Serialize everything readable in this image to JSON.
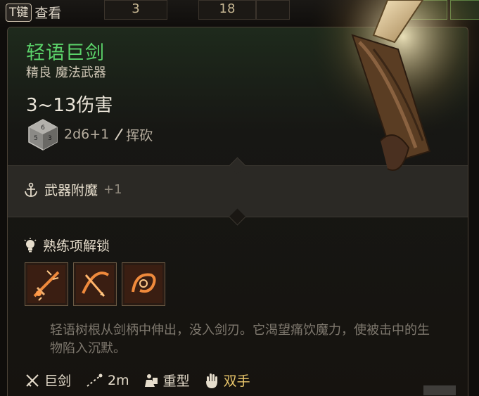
{
  "topbar": {
    "key_label": "T键",
    "view_label": "查看",
    "slot_value_1": "3",
    "slot_value_2": "18"
  },
  "item": {
    "name": "轻语巨剑",
    "rarity_type": "精良 魔法武器",
    "damage": "3~13伤害",
    "dice": "2d6+1",
    "damage_type": "挥砍",
    "name_color": "#5bd36a"
  },
  "enchantment": {
    "label": "武器附魔",
    "value": "+1",
    "icon": "anchor-icon"
  },
  "proficiency": {
    "label": "熟练项解锁",
    "icon": "lightbulb-icon",
    "abilities": [
      {
        "icon": "sword-strike-icon"
      },
      {
        "icon": "cleave-icon"
      },
      {
        "icon": "slash-spiral-icon"
      }
    ]
  },
  "lore": "轻语树根从剑柄中伸出，没入剑刃。它渴望痛饮魔力，使被击中的生物陷入沉默。",
  "properties": [
    {
      "icon": "crossed-swords-icon",
      "value": "巨剑"
    },
    {
      "icon": "range-icon",
      "value": "2m"
    },
    {
      "icon": "heavy-icon",
      "value": "重型"
    },
    {
      "icon": "hand-icon",
      "value": "双手"
    }
  ]
}
